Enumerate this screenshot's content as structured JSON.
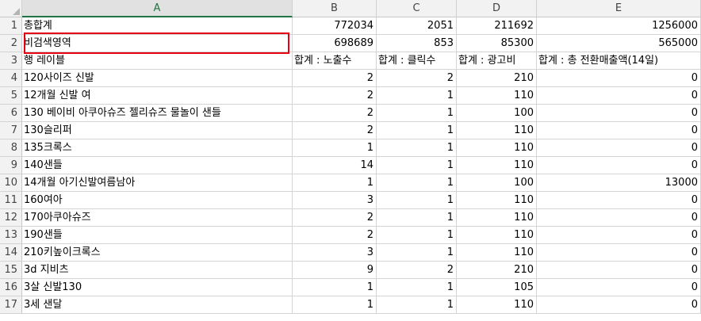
{
  "columns": [
    "A",
    "B",
    "C",
    "D",
    "E"
  ],
  "rows": [
    {
      "n": "1",
      "a": "총합계",
      "b": "772034",
      "c": "2051",
      "d": "211692",
      "e": "1256000"
    },
    {
      "n": "2",
      "a": "비검색영역",
      "b": "698689",
      "c": "853",
      "d": "85300",
      "e": "565000"
    },
    {
      "n": "3",
      "a": "행 레이블",
      "b": "합계 : 노출수",
      "c": "합계 : 클릭수",
      "d": "합계 : 광고비",
      "e": "합계 : 총 전환매출액(14일)"
    },
    {
      "n": "4",
      "a": "120사이즈 신발",
      "b": "2",
      "c": "2",
      "d": "210",
      "e": "0"
    },
    {
      "n": "5",
      "a": "12개월 신발 여",
      "b": "2",
      "c": "1",
      "d": "110",
      "e": "0"
    },
    {
      "n": "6",
      "a": "130 베이비 아쿠아슈즈 젤리슈즈 물놀이 샌들",
      "b": "2",
      "c": "1",
      "d": "100",
      "e": "0"
    },
    {
      "n": "7",
      "a": "130슬리퍼",
      "b": "2",
      "c": "1",
      "d": "110",
      "e": "0"
    },
    {
      "n": "8",
      "a": "135크록스",
      "b": "1",
      "c": "1",
      "d": "110",
      "e": "0"
    },
    {
      "n": "9",
      "a": "140샌들",
      "b": "14",
      "c": "1",
      "d": "110",
      "e": "0"
    },
    {
      "n": "10",
      "a": "14개월 아기신발여름남아",
      "b": "1",
      "c": "1",
      "d": "100",
      "e": "13000"
    },
    {
      "n": "11",
      "a": "160여아",
      "b": "3",
      "c": "1",
      "d": "110",
      "e": "0"
    },
    {
      "n": "12",
      "a": "170아쿠아슈즈",
      "b": "2",
      "c": "1",
      "d": "110",
      "e": "0"
    },
    {
      "n": "13",
      "a": "190샌들",
      "b": "2",
      "c": "1",
      "d": "110",
      "e": "0"
    },
    {
      "n": "14",
      "a": "210키높이크록스",
      "b": "3",
      "c": "1",
      "d": "110",
      "e": "0"
    },
    {
      "n": "15",
      "a": "3d 지비츠",
      "b": "9",
      "c": "2",
      "d": "210",
      "e": "0"
    },
    {
      "n": "16",
      "a": "3살 신발130",
      "b": "1",
      "c": "1",
      "d": "105",
      "e": "0"
    },
    {
      "n": "17",
      "a": "3세 샌달",
      "b": "1",
      "c": "1",
      "d": "110",
      "e": "0"
    }
  ]
}
